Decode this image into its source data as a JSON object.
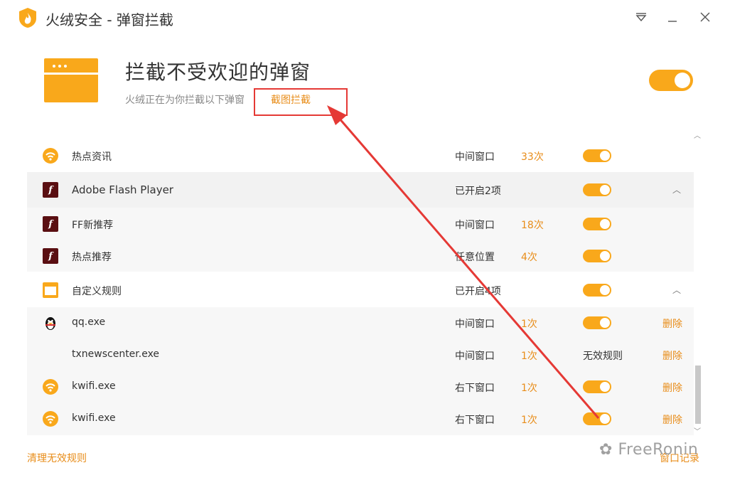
{
  "window": {
    "title": "火绒安全 - 弹窗拦截",
    "logo": "huorong-flame-logo"
  },
  "header": {
    "title": "拦截不受欢迎的弹窗",
    "subtitle": "火绒正在为你拦截以下弹窗",
    "screenshot_link": "截图拦截",
    "master_toggle": "on"
  },
  "list": {
    "rows": [
      {
        "name": "热点资讯",
        "position": "中间窗口",
        "count": "33次",
        "toggle": "on",
        "icon": "wifi-icon"
      },
      {
        "name": "Adobe Flash Player",
        "status": "已开启2项",
        "toggle": "on",
        "icon": "flash-icon",
        "group": true
      },
      {
        "name": "FF新推荐",
        "position": "中间窗口",
        "count": "18次",
        "toggle": "on",
        "icon": "flash-icon"
      },
      {
        "name": "热点推荐",
        "position": "任意位置",
        "count": "4次",
        "toggle": "on",
        "icon": "flash-icon"
      },
      {
        "name": "自定义规则",
        "status": "已开启4项",
        "toggle": "on",
        "icon": "custom-rule-icon",
        "group": true
      },
      {
        "name": "qq.exe",
        "position": "中间窗口",
        "count": "1次",
        "toggle": "on",
        "delete": "删除",
        "icon": "qq-penguin-icon"
      },
      {
        "name": "txnewscenter.exe",
        "position": "中间窗口",
        "count": "1次",
        "invalid": "无效规则",
        "delete": "删除"
      },
      {
        "name": "kwifi.exe",
        "position": "右下窗口",
        "count": "1次",
        "toggle": "on",
        "delete": "删除",
        "icon": "wifi-icon"
      },
      {
        "name": "kwifi.exe",
        "position": "右下窗口",
        "count": "1次",
        "toggle": "on",
        "delete": "删除",
        "icon": "wifi-icon"
      }
    ]
  },
  "footer": {
    "clean_invalid": "清理无效规则",
    "window_log": "窗口记录"
  },
  "watermark": "FreeRonin",
  "colors": {
    "accent": "#f9a81b",
    "link": "#e88d1a",
    "annotation": "#e53935"
  }
}
